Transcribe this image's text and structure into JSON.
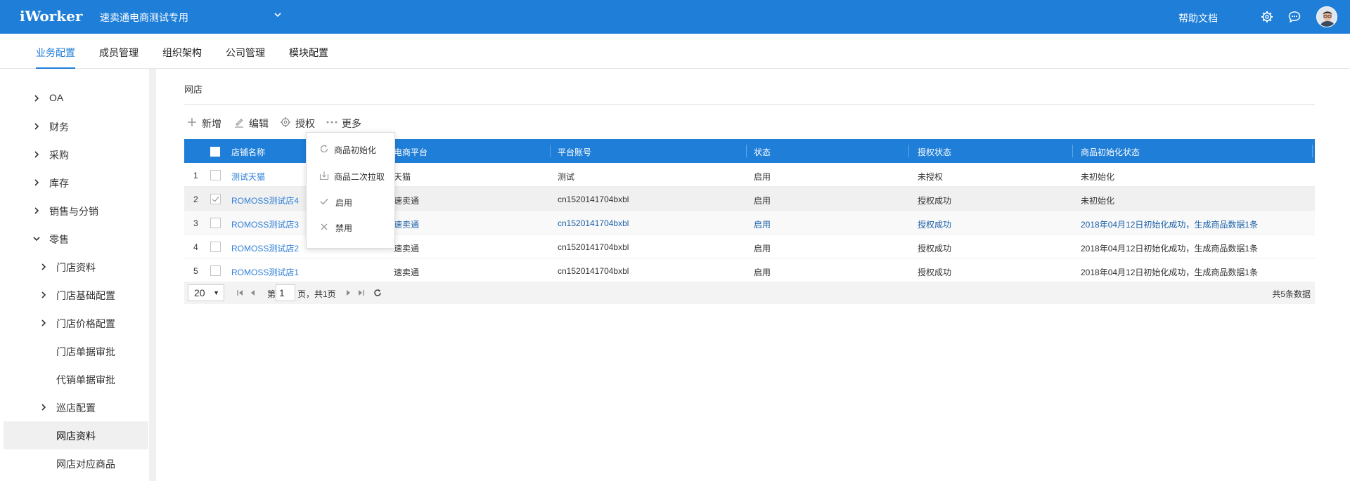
{
  "app": {
    "logo": "iWorker",
    "company": "速卖通电商测试专用",
    "help": "帮助文档"
  },
  "nav_tabs": [
    {
      "label": "业务配置",
      "active": true
    },
    {
      "label": "成员管理",
      "active": false
    },
    {
      "label": "组织架构",
      "active": false
    },
    {
      "label": "公司管理",
      "active": false
    },
    {
      "label": "模块配置",
      "active": false
    }
  ],
  "sidebar": {
    "items": [
      {
        "label": "OA"
      },
      {
        "label": "财务"
      },
      {
        "label": "采购"
      },
      {
        "label": "库存"
      },
      {
        "label": "销售与分销"
      },
      {
        "label": "零售"
      },
      {
        "label": "门店资料"
      },
      {
        "label": "门店基础配置"
      },
      {
        "label": "门店价格配置"
      },
      {
        "label": "门店单据审批"
      },
      {
        "label": "代销单据审批"
      },
      {
        "label": "巡店配置"
      },
      {
        "label": "网店资料"
      },
      {
        "label": "网店对应商品"
      }
    ]
  },
  "breadcrumb": "网店",
  "toolbar": {
    "add": "新增",
    "edit": "编辑",
    "auth": "授权",
    "more": "更多"
  },
  "dropdown": {
    "items": [
      {
        "label": "商品初始化"
      },
      {
        "label": "商品二次拉取"
      },
      {
        "label": "启用"
      },
      {
        "label": "禁用"
      }
    ]
  },
  "table": {
    "columns": [
      "店铺名称",
      "电商平台",
      "平台账号",
      "状态",
      "授权状态",
      "商品初始化状态"
    ],
    "rows": [
      {
        "index": "1",
        "name": "测试天猫",
        "platform": "天猫",
        "account": "测试",
        "status": "启用",
        "auth": "未授权",
        "init": "未初始化",
        "checked": false
      },
      {
        "index": "2",
        "name": "ROMOSS测试店4",
        "platform": "速卖通",
        "account": "cn1520141704bxbl",
        "status": "启用",
        "auth": "授权成功",
        "init": "未初始化",
        "checked": true
      },
      {
        "index": "3",
        "name": "ROMOSS测试店3",
        "platform": "速卖通",
        "account": "cn1520141704bxbl",
        "status": "启用",
        "auth": "授权成功",
        "init": "2018年04月12日初始化成功，生成商品数据1条",
        "checked": false
      },
      {
        "index": "4",
        "name": "ROMOSS测试店2",
        "platform": "速卖通",
        "account": "cn1520141704bxbl",
        "status": "启用",
        "auth": "授权成功",
        "init": "2018年04月12日初始化成功，生成商品数据1条",
        "checked": false
      },
      {
        "index": "5",
        "name": "ROMOSS测试店1",
        "platform": "速卖通",
        "account": "cn1520141704bxbl",
        "status": "启用",
        "auth": "授权成功",
        "init": "2018年04月12日初始化成功，生成商品数据1条",
        "checked": false
      }
    ]
  },
  "pager": {
    "page_size": "20",
    "page_prefix": "第",
    "page": "1",
    "page_suffix": "页，共1页",
    "total": "共5条数据"
  },
  "colors": {
    "brand": "#1e7ed8",
    "link": "#2e7fd6",
    "selected_row": "#f0f0f0"
  }
}
